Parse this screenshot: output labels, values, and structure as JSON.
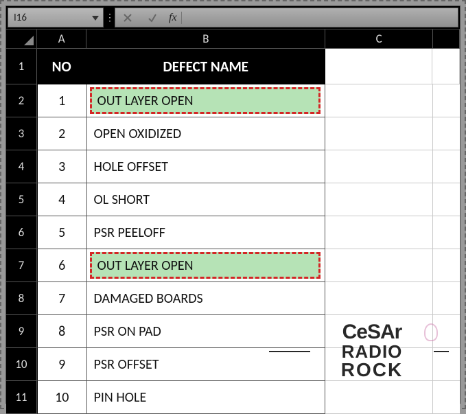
{
  "formula_bar": {
    "cell_ref": "I16",
    "fx_label": "fx",
    "formula_value": ""
  },
  "columns": {
    "A": "A",
    "B": "B",
    "C": "C"
  },
  "header": {
    "no": "NO",
    "defect_name": "DEFECT NAME"
  },
  "rows": [
    {
      "num": "1",
      "no": "",
      "name": "",
      "is_header": true
    },
    {
      "num": "2",
      "no": "1",
      "name": "OUT LAYER OPEN",
      "highlight": true
    },
    {
      "num": "3",
      "no": "2",
      "name": "OPEN OXIDIZED"
    },
    {
      "num": "4",
      "no": "3",
      "name": "HOLE OFFSET"
    },
    {
      "num": "5",
      "no": "4",
      "name": "OL SHORT"
    },
    {
      "num": "6",
      "no": "5",
      "name": "PSR PEELOFF"
    },
    {
      "num": "7",
      "no": "6",
      "name": "OUT LAYER OPEN",
      "highlight": true
    },
    {
      "num": "8",
      "no": "7",
      "name": "DAMAGED BOARDS"
    },
    {
      "num": "9",
      "no": "8",
      "name": "PSR ON PAD"
    },
    {
      "num": "10",
      "no": "9",
      "name": "PSR OFFSET"
    },
    {
      "num": "11",
      "no": "10",
      "name": "PIN HOLE"
    }
  ],
  "watermark": {
    "line1": "CeSAr",
    "line2": "RADIO",
    "line3": "ROCK"
  }
}
